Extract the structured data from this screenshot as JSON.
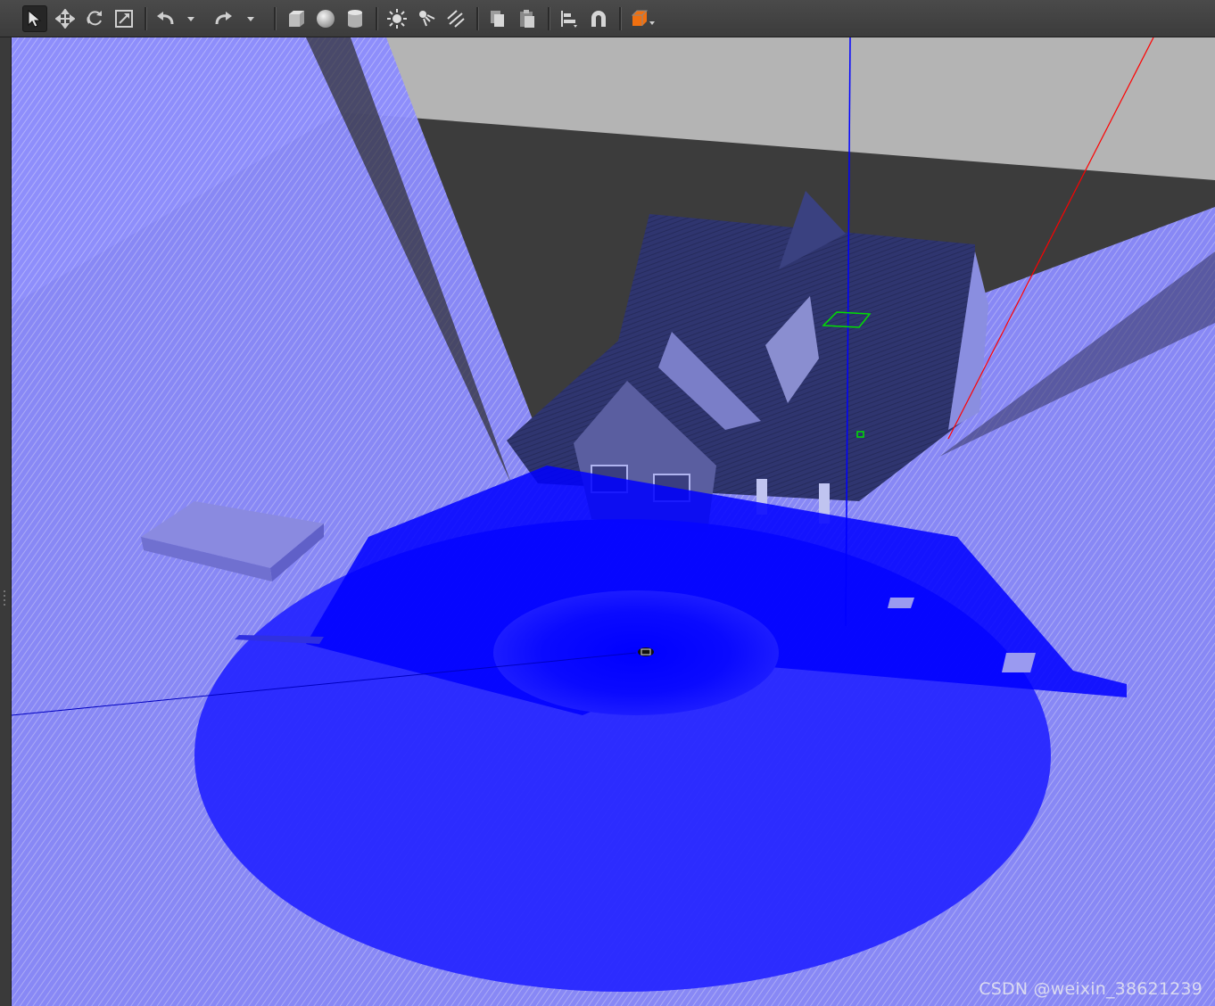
{
  "toolbar": {
    "tools": [
      {
        "name": "select-mode-button",
        "icon": "cursor-arrow-icon",
        "active": true
      },
      {
        "name": "translate-mode-button",
        "icon": "move-arrows-icon"
      },
      {
        "name": "rotate-mode-button",
        "icon": "rotate-icon"
      },
      {
        "name": "scale-mode-button",
        "icon": "scale-icon"
      },
      {
        "name": "undo-button",
        "icon": "undo-icon"
      },
      {
        "name": "undo-history-button",
        "icon": "dropdown-arrow-icon"
      },
      {
        "name": "redo-button",
        "icon": "redo-icon"
      },
      {
        "name": "redo-history-button",
        "icon": "dropdown-arrow-icon"
      },
      {
        "name": "insert-box-button",
        "icon": "box-shape-icon"
      },
      {
        "name": "insert-sphere-button",
        "icon": "sphere-shape-icon"
      },
      {
        "name": "insert-cylinder-button",
        "icon": "cylinder-shape-icon"
      },
      {
        "name": "point-light-button",
        "icon": "point-light-icon"
      },
      {
        "name": "spot-light-button",
        "icon": "spot-light-icon"
      },
      {
        "name": "directional-light-button",
        "icon": "directional-light-icon"
      },
      {
        "name": "copy-button",
        "icon": "copy-icon"
      },
      {
        "name": "paste-button",
        "icon": "paste-icon"
      },
      {
        "name": "align-button",
        "icon": "align-icon"
      },
      {
        "name": "snap-button",
        "icon": "magnet-icon"
      },
      {
        "name": "view-angle-button",
        "icon": "view-cube-icon"
      }
    ]
  },
  "colors": {
    "toolbar_bg": "#434343",
    "sky": "#b4b4b4",
    "ground": "#3c3c3c",
    "laser": "#0000ff",
    "laser_light": "#8c8cff",
    "house_roof": "#2e3470",
    "x_axis": "#ff0000",
    "z_axis": "#0000ff",
    "selection": "#00e000",
    "view_cube_accent": "#f07010"
  },
  "watermark": {
    "text": "CSDN @weixin_38621239"
  }
}
